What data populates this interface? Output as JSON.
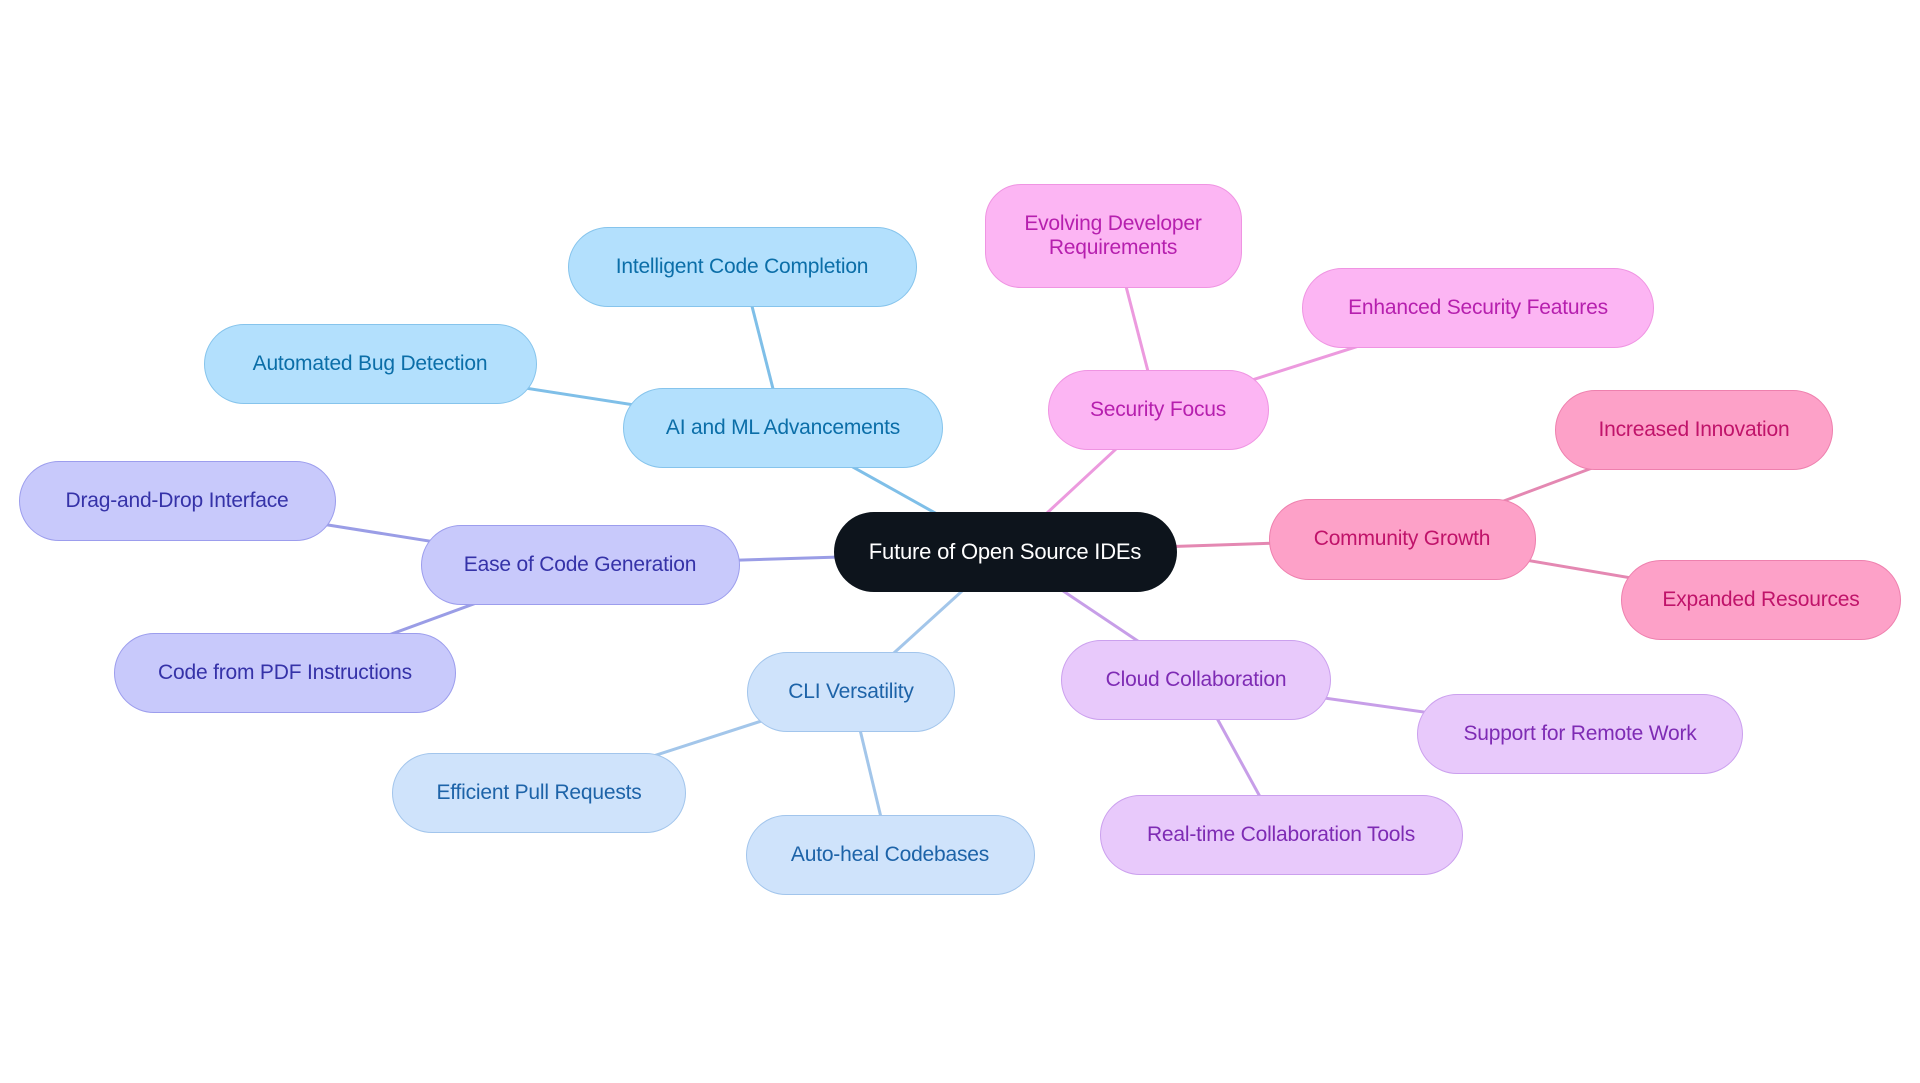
{
  "title": "Future of Open Source IDEs",
  "branch_styles": {
    "root": {
      "fill": "#0d141c",
      "stroke": "#0d141c",
      "text": "#ffffff",
      "edge": "#0d141c"
    },
    "ai": {
      "fill": "#b3e0fd",
      "stroke": "#86c4ec",
      "text": "#0b6ea8",
      "edge": "#7fbfe8"
    },
    "ease": {
      "fill": "#c8c9fb",
      "stroke": "#9c9ded",
      "text": "#3532a8",
      "edge": "#9a9de6"
    },
    "cli": {
      "fill": "#cfe3fb",
      "stroke": "#a2c5ec",
      "text": "#1d63a8",
      "edge": "#a3c6ea"
    },
    "cloud": {
      "fill": "#e8c9fb",
      "stroke": "#cba0ee",
      "text": "#7e2bb4",
      "edge": "#c79ee8"
    },
    "security": {
      "fill": "#fcb5f3",
      "stroke": "#ef94e2",
      "text": "#b61fae",
      "edge": "#ec9ade"
    },
    "community": {
      "fill": "#fda1c8",
      "stroke": "#ee80ae",
      "text": "#c0136a",
      "edge": "#e488b2"
    }
  },
  "nodes": [
    {
      "id": "root",
      "label": "Future of Open Source IDEs",
      "branch": "root"
    },
    {
      "id": "ai",
      "label": "AI and ML Advancements",
      "branch": "ai",
      "parent": "root"
    },
    {
      "id": "ai-1",
      "label": "Intelligent Code Completion",
      "branch": "ai",
      "parent": "ai"
    },
    {
      "id": "ai-2",
      "label": "Automated Bug Detection",
      "branch": "ai",
      "parent": "ai"
    },
    {
      "id": "ease",
      "label": "Ease of Code Generation",
      "branch": "ease",
      "parent": "root"
    },
    {
      "id": "ease-1",
      "label": "Drag-and-Drop Interface",
      "branch": "ease",
      "parent": "ease"
    },
    {
      "id": "ease-2",
      "label": "Code from PDF Instructions",
      "branch": "ease",
      "parent": "ease"
    },
    {
      "id": "cli",
      "label": "CLI Versatility",
      "branch": "cli",
      "parent": "root"
    },
    {
      "id": "cli-1",
      "label": "Efficient Pull Requests",
      "branch": "cli",
      "parent": "cli"
    },
    {
      "id": "cli-2",
      "label": "Auto-heal Codebases",
      "branch": "cli",
      "parent": "cli"
    },
    {
      "id": "cloud",
      "label": "Cloud Collaboration",
      "branch": "cloud",
      "parent": "root"
    },
    {
      "id": "cloud-1",
      "label": "Support for Remote Work",
      "branch": "cloud",
      "parent": "cloud"
    },
    {
      "id": "cloud-2",
      "label": "Real-time Collaboration Tools",
      "branch": "cloud",
      "parent": "cloud"
    },
    {
      "id": "security",
      "label": "Security Focus",
      "branch": "security",
      "parent": "root"
    },
    {
      "id": "security-1",
      "label": "Evolving Developer Requirements",
      "branch": "security",
      "parent": "security"
    },
    {
      "id": "security-2",
      "label": "Enhanced Security Features",
      "branch": "security",
      "parent": "security"
    },
    {
      "id": "community",
      "label": "Community Growth",
      "branch": "community",
      "parent": "root"
    },
    {
      "id": "community-1",
      "label": "Increased Innovation",
      "branch": "community",
      "parent": "community"
    },
    {
      "id": "community-2",
      "label": "Expanded Resources",
      "branch": "community",
      "parent": "community"
    }
  ]
}
